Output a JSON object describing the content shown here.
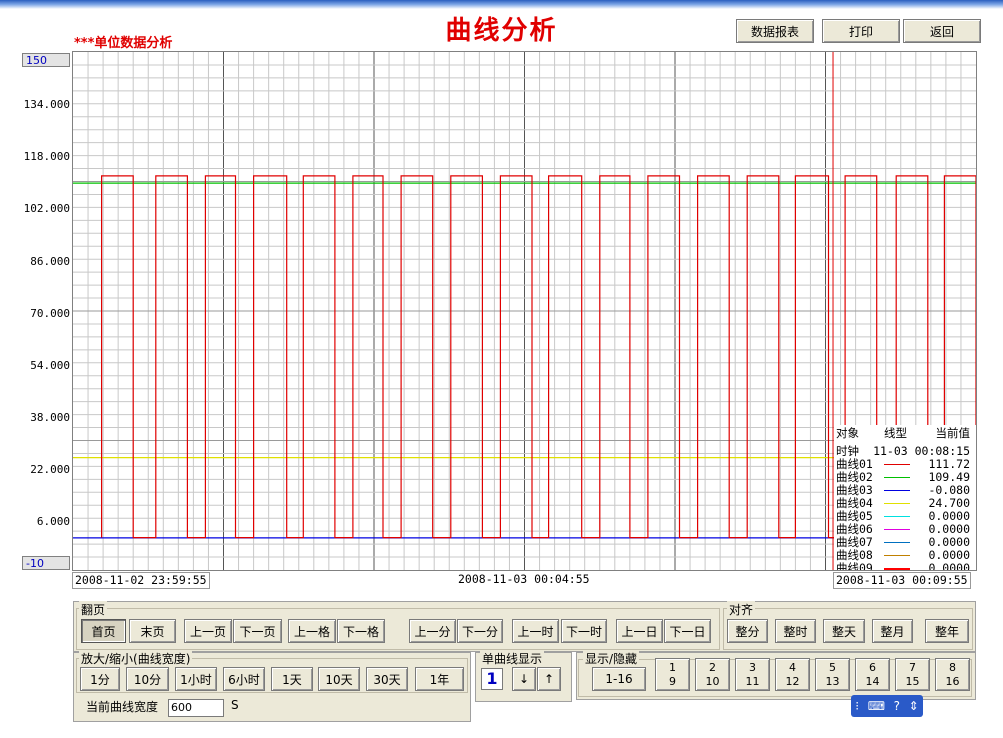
{
  "title": "曲线分析",
  "subtitle": "***单位数据分析",
  "top_buttons": [
    "数据报表",
    "打印",
    "返回"
  ],
  "y_axis": {
    "top_value": "150",
    "bottom_value": "-10",
    "ticks": [
      "134.000",
      "118.000",
      "102.000",
      "86.000",
      "70.000",
      "54.000",
      "38.000",
      "22.000",
      "6.000"
    ]
  },
  "time_axis": {
    "start": "2008-11-02 23:59:55",
    "middle": "2008-11-03 00:04:55",
    "end": "2008-11-03 00:09:55"
  },
  "legend": {
    "header": [
      "对象",
      "线型",
      "当前值"
    ],
    "clock_label": "时钟",
    "clock_value": "11-03 00:08:15",
    "rows": [
      {
        "name": "曲线01",
        "color": "#e00000",
        "value": "111.72"
      },
      {
        "name": "曲线02",
        "color": "#00c000",
        "value": "109.49"
      },
      {
        "name": "曲线03",
        "color": "#0000e0",
        "value": "-0.080"
      },
      {
        "name": "曲线04",
        "color": "#e0e000",
        "value": "24.700"
      },
      {
        "name": "曲线05",
        "color": "#00e0e0",
        "value": "0.0000"
      },
      {
        "name": "曲线06",
        "color": "#e000e0",
        "value": "0.0000"
      },
      {
        "name": "曲线07",
        "color": "#0070c0",
        "value": "0.0000"
      },
      {
        "name": "曲线08",
        "color": "#c08000",
        "value": "0.0000"
      },
      {
        "name": "曲线09",
        "color": "#ff0000",
        "value": "0.0000"
      }
    ]
  },
  "chart_data": {
    "type": "line",
    "x_start": "2008-11-02 23:59:55",
    "x_end": "2008-11-03 00:09:55",
    "ylim": [
      -10,
      150
    ],
    "series": [
      {
        "name": "曲线01",
        "color": "#e00000",
        "pattern": "square-wave",
        "high": 111.72,
        "low": 0,
        "high_segments": [
          [
            1.9,
            4.0
          ],
          [
            5.5,
            7.6
          ],
          [
            8.8,
            10.8
          ],
          [
            12.0,
            14.2
          ],
          [
            15.3,
            17.4
          ],
          [
            18.6,
            20.6
          ],
          [
            21.8,
            23.9
          ],
          [
            25.1,
            27.2
          ],
          [
            28.4,
            30.5
          ],
          [
            31.6,
            33.8
          ],
          [
            35.0,
            37.0
          ],
          [
            38.2,
            40.3
          ],
          [
            41.5,
            43.6
          ],
          [
            44.8,
            46.9
          ],
          [
            48.0,
            50.2
          ],
          [
            51.3,
            53.4
          ],
          [
            54.7,
            56.8
          ],
          [
            57.9,
            60.0
          ]
        ]
      },
      {
        "name": "曲线02",
        "color": "#00c000",
        "constant": 109.49
      },
      {
        "name": "曲线03",
        "color": "#0000e0",
        "constant": -0.08
      },
      {
        "name": "曲线04",
        "color": "#e0e000",
        "constant": 24.7
      }
    ],
    "cursor_time": "2008-11-03 00:08:15"
  },
  "paging": {
    "label": "翻页",
    "buttons": [
      "首页",
      "末页",
      "上一页",
      "下一页",
      "上一格",
      "下一格",
      "上一分",
      "下一分",
      "上一时",
      "下一时",
      "上一日",
      "下一日"
    ]
  },
  "align": {
    "label": "对齐",
    "buttons": [
      "整分",
      "整时",
      "整天",
      "整月",
      "整年"
    ]
  },
  "zoom": {
    "label": "放大/缩小(曲线宽度)",
    "buttons": [
      "1分",
      "10分",
      "1小时",
      "6小时",
      "1天",
      "10天",
      "30天",
      "1年"
    ],
    "width_label": "当前曲线宽度",
    "width_value": "600",
    "width_unit": "S"
  },
  "single": {
    "label": "单曲线显示",
    "value": "1",
    "down": "↓",
    "up": "↑"
  },
  "display": {
    "label": "显示/隐藏",
    "range_button": "1-16",
    "buttons": [
      [
        "1",
        "9"
      ],
      [
        "2",
        "10"
      ],
      [
        "3",
        "11"
      ],
      [
        "4",
        "12"
      ],
      [
        "5",
        "13"
      ],
      [
        "6",
        "14"
      ],
      [
        "7",
        "15"
      ],
      [
        "8",
        "16"
      ]
    ]
  }
}
